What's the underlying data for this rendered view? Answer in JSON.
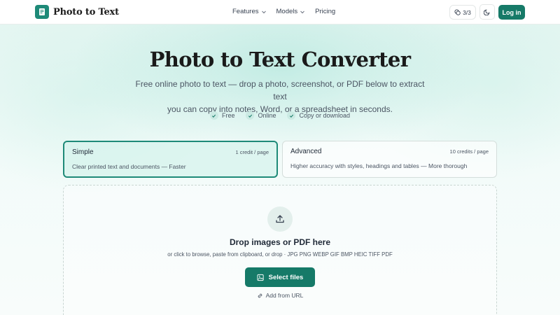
{
  "header": {
    "brand": "Photo to Text",
    "nav": [
      "Features",
      "Models",
      "Pricing"
    ],
    "credits": "3/3",
    "login_label": "Log in"
  },
  "hero": {
    "title": "Photo to Text Converter",
    "subtitle_line1": "Free online photo to text — drop a photo, screenshot, or PDF below to extract text",
    "subtitle_line2": "you can copy into notes, Word, or a spreadsheet in seconds.",
    "features": [
      "Free",
      "Online",
      "Copy or download"
    ]
  },
  "modes": [
    {
      "name": "Simple",
      "cost": "1 credit / page",
      "desc": "Clear printed text and documents — Faster",
      "selected": true
    },
    {
      "name": "Advanced",
      "cost": "10 credits / page",
      "desc": "Higher accuracy with styles, headings and tables — More thorough",
      "selected": false
    }
  ],
  "dropzone": {
    "title": "Drop images or PDF here",
    "hint": "or click to browse, paste from clipboard, or drop · JPG PNG WEBP GIF BMP HEIC TIFF PDF",
    "select_label": "Select files",
    "url_label": "Add from URL"
  },
  "icons": {
    "brand": "document-image-icon",
    "credits": "coins-icon",
    "theme": "moon-icon",
    "check": "check-icon",
    "upload": "upload-icon",
    "select": "image-add-icon",
    "url": "link-icon"
  },
  "colors": {
    "accent": "#167a68",
    "accent_light": "#cbeae3",
    "background_tint": "#e6f6f2"
  }
}
